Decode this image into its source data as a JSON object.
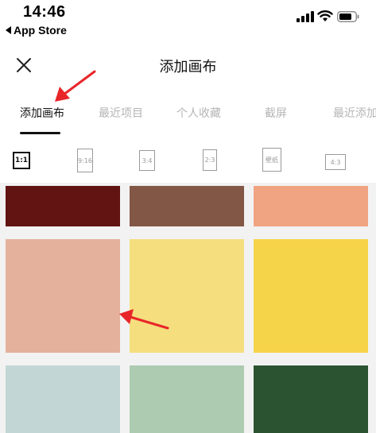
{
  "status_bar": {
    "time": "14:46",
    "back_app_label": "App Store",
    "icons": [
      "cellular-signal-icon",
      "wifi-icon",
      "battery-icon"
    ]
  },
  "header": {
    "title": "添加画布",
    "close_icon": "close-icon"
  },
  "tabs": [
    {
      "label": "添加画布",
      "active": true
    },
    {
      "label": "最近项目",
      "active": false
    },
    {
      "label": "个人收藏",
      "active": false
    },
    {
      "label": "截屏",
      "active": false
    },
    {
      "label": "最近添加",
      "active": false
    }
  ],
  "ratios": [
    {
      "label": "1:1",
      "active": true
    },
    {
      "label": "9:16",
      "active": false
    },
    {
      "label": "3:4",
      "active": false
    },
    {
      "label": "2:3",
      "active": false
    },
    {
      "label": "壁纸",
      "active": false
    },
    {
      "label": "4:3",
      "active": false
    }
  ],
  "swatches": [
    {
      "color": "#611412"
    },
    {
      "color": "#835745"
    },
    {
      "color": "#f0a482"
    },
    {
      "color": "#e4b19c"
    },
    {
      "color": "#f5de7e"
    },
    {
      "color": "#f6d44a"
    },
    {
      "color": "#c3d6d6"
    },
    {
      "color": "#accbb0"
    },
    {
      "color": "#2c5331"
    }
  ],
  "annotation_color": "#e8262a"
}
